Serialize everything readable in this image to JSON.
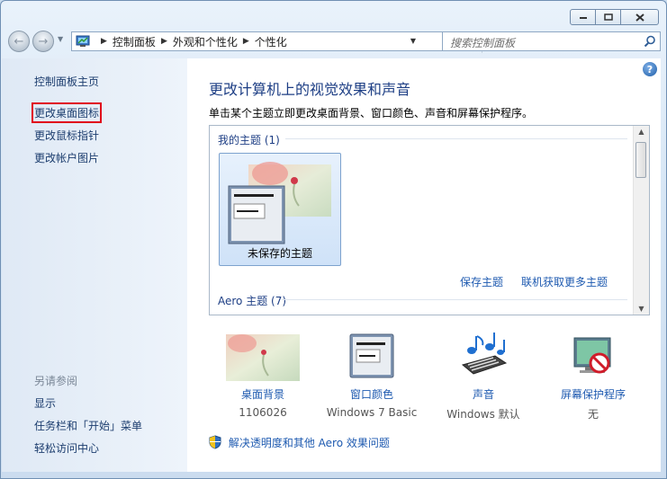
{
  "window": {
    "minimize_icon": "minimize-icon",
    "maximize_icon": "maximize-icon",
    "close_icon": "close-icon"
  },
  "address": {
    "crumbs": [
      "控制面板",
      "外观和个性化",
      "个性化"
    ],
    "search_placeholder": "搜索控制面板"
  },
  "sidebar": {
    "home": "控制面板主页",
    "links": [
      "更改桌面图标",
      "更改鼠标指针",
      "更改帐户图片"
    ],
    "see_also_label": "另请参阅",
    "see_also": [
      "显示",
      "任务栏和「开始」菜单",
      "轻松访问中心"
    ]
  },
  "main": {
    "title": "更改计算机上的视觉效果和声音",
    "subtitle": "单击某个主题立即更改桌面背景、窗口颜色、声音和屏幕保护程序。",
    "my_themes_label": "我的主题 (1)",
    "unsaved_theme": "未保存的主题",
    "save_theme": "保存主题",
    "more_themes": "联机获取更多主题",
    "aero_label": "Aero 主题 (7)",
    "options": [
      {
        "name": "桌面背景",
        "value": "1106026"
      },
      {
        "name": "窗口颜色",
        "value": "Windows 7 Basic"
      },
      {
        "name": "声音",
        "value": "Windows 默认"
      },
      {
        "name": "屏幕保护程序",
        "value": "无"
      }
    ],
    "troubleshoot": "解决透明度和其他 Aero 效果问题"
  }
}
